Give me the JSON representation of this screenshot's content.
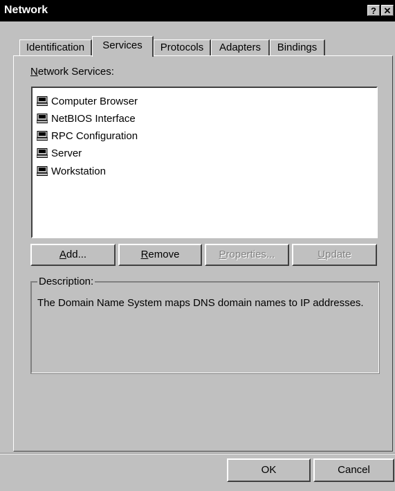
{
  "window": {
    "title": "Network",
    "help_glyph": "?",
    "close_glyph": "✕"
  },
  "tabs": [
    {
      "label": "Identification",
      "active": false
    },
    {
      "label": "Services",
      "active": true
    },
    {
      "label": "Protocols",
      "active": false
    },
    {
      "label": "Adapters",
      "active": false
    },
    {
      "label": "Bindings",
      "active": false
    }
  ],
  "services": {
    "label_prefix": "",
    "label_mnemonic": "N",
    "label_rest": "etwork Services:",
    "items": [
      {
        "name": "Computer Browser",
        "icon": "computer-icon"
      },
      {
        "name": "NetBIOS Interface",
        "icon": "computer-icon"
      },
      {
        "name": "RPC Configuration",
        "icon": "computer-icon"
      },
      {
        "name": "Server",
        "icon": "computer-icon"
      },
      {
        "name": "Workstation",
        "icon": "computer-icon"
      }
    ]
  },
  "buttons": {
    "add": {
      "mnemonic": "A",
      "rest": "dd..."
    },
    "remove": {
      "mnemonic": "R",
      "rest": "emove"
    },
    "properties": {
      "mnemonic": "P",
      "rest": "roperties..."
    },
    "update": {
      "mnemonic": "U",
      "rest": "pdate"
    },
    "ok": "OK",
    "cancel": "Cancel"
  },
  "description": {
    "legend": "Description:",
    "text": "The Domain Name System maps DNS domain names to IP addresses."
  }
}
